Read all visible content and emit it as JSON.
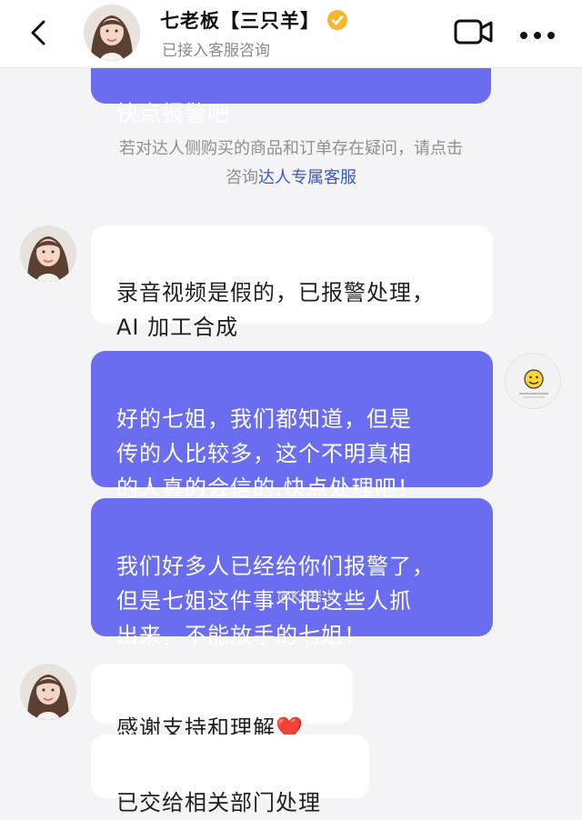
{
  "header": {
    "name": "七老板【三只羊】",
    "status": "已接入客服咨询"
  },
  "messages": [
    {
      "text": "快点报警吧"
    },
    {
      "text": "录音视频是假的，已报警处理，\nAI 加工合成"
    },
    {
      "text": "好的七姐，我们都知道，但是\n传的人比较多，这个不明真相\n的人真的会信的,快点处理吧！"
    },
    {
      "text": "我们好多人已经给你们报警了，\n但是七姐这件事不把这些人抓\n出来，不能放手的七姐！"
    },
    {
      "text": "感谢支持和理解",
      "emoji": "❤️"
    },
    {
      "text": "已交给相关部门处理"
    }
  ],
  "notice": {
    "line1": "若对达人侧购买的商品和订单存在疑问，请点击",
    "line2_prefix": "咨询",
    "link": "达人专属客服"
  },
  "watermark": "@KS岩少",
  "colors": {
    "outgoing_bubble": "#6a6df0",
    "incoming_bubble": "#ffffff",
    "verified_badge": "#f5b72e",
    "link": "#3b57c8"
  }
}
